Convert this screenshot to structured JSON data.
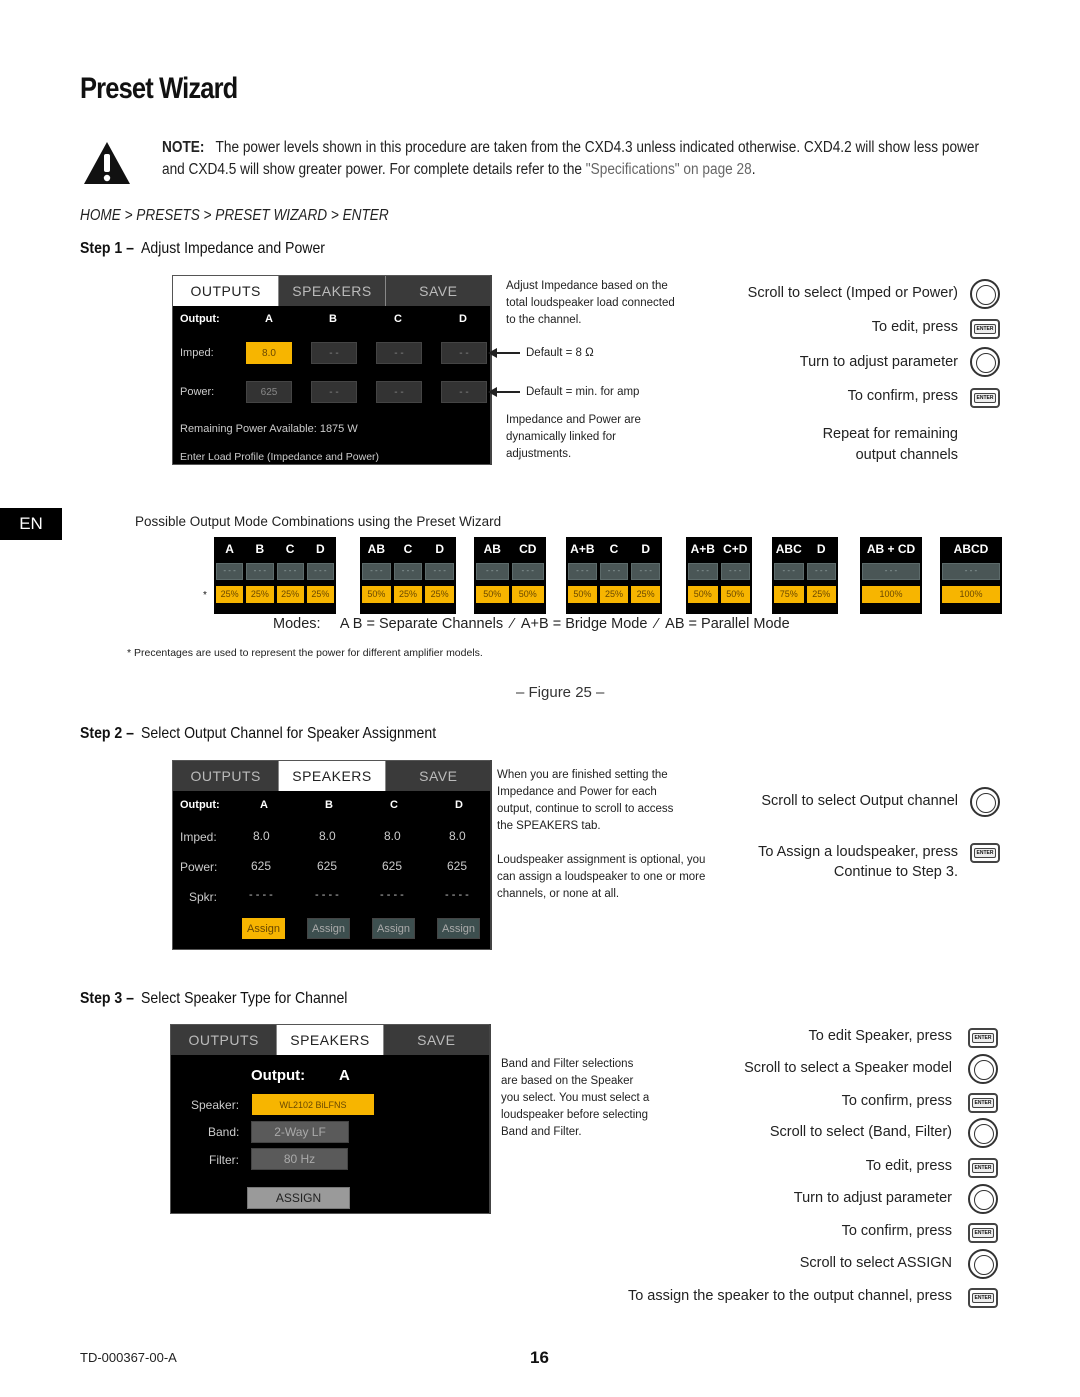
{
  "page": {
    "title": "Preset Wizard",
    "note_label": "NOTE:",
    "note_text": "The power levels shown in this procedure are taken from the CXD4.3 unless indicated otherwise. CXD4.2 will show less power and CXD4.5 will show greater power. For complete details refer to the ",
    "note_link": "\"Specifications\" on page 28",
    "note_end": ".",
    "breadcrumb": "HOME > PRESETS > PRESET WIZARD > ENTER",
    "language_tab": "EN",
    "footer_doc_id": "TD-000367-00-A",
    "page_number": "16"
  },
  "tabs": [
    "OUTPUTS",
    "SPEAKERS",
    "SAVE"
  ],
  "step1": {
    "label": "Step 1 –",
    "title": "Adjust Impedance and Power",
    "screen": {
      "output_label": "Output:",
      "channels": [
        "A",
        "B",
        "C",
        "D"
      ],
      "imped_label": "Imped:",
      "imped_values": [
        "8.0",
        "- -",
        "- -",
        "- -"
      ],
      "power_label": "Power:",
      "power_values": [
        "625",
        "- -",
        "- -",
        "- -"
      ],
      "remaining": "Remaining Power Available:  1875 W",
      "footer": "Enter Load Profile (Impedance and Power)"
    },
    "notes": {
      "adjust": "Adjust Impedance based on the total loudspeaker load connected to the channel.",
      "default_imped": "Default = 8 Ω",
      "default_power": "Default = min. for amp",
      "linked": "Impedance and Power are dynamically linked for adjustments."
    },
    "instructions": [
      {
        "text": "Scroll to select (Imped or Power)",
        "icon": "knob"
      },
      {
        "text": "To edit, press",
        "icon": "enter"
      },
      {
        "text": "Turn to adjust parameter",
        "icon": "knob"
      },
      {
        "text": "To confirm, press",
        "icon": "enter"
      }
    ],
    "repeat_line1": "Repeat for remaining",
    "repeat_line2": "output channels"
  },
  "modes": {
    "heading": "Possible Output Mode Combinations using the Preset Wizard",
    "asterisk": "*",
    "groups": [
      {
        "headers": [
          "A",
          "B",
          "C",
          "D"
        ],
        "percents": [
          "25%",
          "25%",
          "25%",
          "25%"
        ]
      },
      {
        "headers": [
          "AB",
          "C",
          "D"
        ],
        "percents": [
          "50%",
          "25%",
          "25%"
        ]
      },
      {
        "headers": [
          "AB",
          "CD"
        ],
        "percents": [
          "50%",
          "50%"
        ]
      },
      {
        "headers": [
          "A+B",
          "C",
          "D"
        ],
        "percents": [
          "50%",
          "25%",
          "25%"
        ]
      },
      {
        "headers": [
          "A+B",
          "C+D"
        ],
        "percents": [
          "50%",
          "50%"
        ]
      },
      {
        "headers": [
          "ABC",
          "D"
        ],
        "percents": [
          "75%",
          "25%"
        ]
      },
      {
        "headers": [
          "AB + CD"
        ],
        "percents": [
          "100%"
        ]
      },
      {
        "headers": [
          "ABCD"
        ],
        "percents": [
          "100%"
        ]
      }
    ],
    "placeholder": "- - -",
    "legend": "Modes:     A B = Separate Channels  ⁄  A+B = Bridge Mode  ⁄  AB = Parallel Mode",
    "footnote": "* Precentages are used to represent the power for different amplifier models.",
    "figure_caption": "– Figure 25 –"
  },
  "step2": {
    "label": "Step 2 –",
    "title": "Select Output Channel for Speaker Assignment",
    "screen": {
      "output_label": "Output:",
      "channels": [
        "A",
        "B",
        "C",
        "D"
      ],
      "imped_label": "Imped:",
      "imped_values": [
        "8.0",
        "8.0",
        "8.0",
        "8.0"
      ],
      "power_label": "Power:",
      "power_values": [
        "625",
        "625",
        "625",
        "625"
      ],
      "spkr_label": "Spkr:",
      "spkr_values": [
        "- - - -",
        "- - - -",
        "- - - -",
        "- - - -"
      ],
      "assign_label": "Assign"
    },
    "notes": {
      "finished": "When you are finished setting the Impedance and Power for each output, continue to scroll to access the SPEAKERS tab.",
      "optional": "Loudspeaker assignment is optional, you can assign a loudspeaker to one or more channels, or none at all."
    },
    "instructions": [
      {
        "text": "Scroll to select Output channel",
        "icon": "knob"
      },
      {
        "text": "To Assign a loudspeaker, press",
        "icon": "enter"
      }
    ],
    "continue": "Continue to Step 3."
  },
  "step3": {
    "label": "Step 3 –",
    "title": "Select Speaker Type for Channel",
    "screen": {
      "output_label": "Output:",
      "output_value": "A",
      "speaker_label": "Speaker:",
      "speaker_value": "WL2102 BiLFNS",
      "band_label": "Band:",
      "band_value": "2-Way LF",
      "filter_label": "Filter:",
      "filter_value": "80 Hz",
      "assign_button": "ASSIGN"
    },
    "notes": {
      "band_filter": "Band and Filter selections are based on the Speaker you select. You must select a loudspeaker before selecting Band and Filter."
    },
    "instructions": [
      {
        "text": "To edit Speaker, press",
        "icon": "enter"
      },
      {
        "text": "Scroll to select a Speaker model",
        "icon": "knob"
      },
      {
        "text": "To confirm, press",
        "icon": "enter"
      },
      {
        "text": "Scroll to select (Band, Filter)",
        "icon": "knob"
      },
      {
        "text": "To edit, press",
        "icon": "enter"
      },
      {
        "text": "Turn to adjust parameter",
        "icon": "knob"
      },
      {
        "text": "To confirm, press",
        "icon": "enter"
      },
      {
        "text": "Scroll to select ASSIGN",
        "icon": "knob"
      },
      {
        "text": "To assign the speaker to the output channel, press",
        "icon": "enter"
      }
    ]
  },
  "colors": {
    "accent_yellow": "#f7b500",
    "screen_bg": "#000000",
    "inactive_tab": "#3a3a3a"
  }
}
